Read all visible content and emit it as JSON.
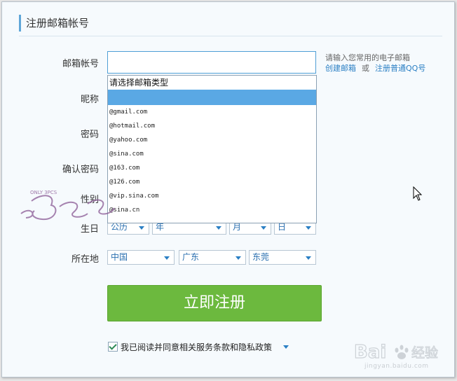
{
  "section": {
    "title": "注册邮箱帐号"
  },
  "labels": {
    "email": "邮箱帐号",
    "nickname": "昵称",
    "password": "密码",
    "confirm_password": "确认密码",
    "gender": "性别",
    "birthday": "生日",
    "location": "所在地"
  },
  "email_field": {
    "value": ""
  },
  "hint": {
    "text": "请输入您常用的电子邮箱",
    "create_link": "创建邮箱",
    "or": "或",
    "qq_link": "注册普通QQ号"
  },
  "email_dropdown": {
    "header": "请选择邮箱类型",
    "options": [
      "@gmail.com",
      "@hotmail.com",
      "@yahoo.com",
      "@sina.com",
      "@163.com",
      "@126.com",
      "@vip.sina.com",
      "@sina.cn"
    ]
  },
  "birthday": {
    "calendar": "公历",
    "year": "年",
    "month": "月",
    "day": "日"
  },
  "location": {
    "country": "中国",
    "province": "广东",
    "city": "东莞"
  },
  "register_button": "立即注册",
  "agreement": {
    "text": "我已阅读并同意相关服务条款和隐私政策",
    "checked": true
  },
  "watermark": {
    "baidu": "Bai",
    "baidu2": "经验",
    "url": "jingyan.baidu.com",
    "logo_text": "ONLY 3PCS"
  },
  "colors": {
    "accent": "#5fa6d8",
    "button": "#6cb93e",
    "link": "#2a7fc4",
    "selected": "#5aa8e4"
  },
  "icons": [
    "checkbox-check-icon",
    "dropdown-arrow-icon",
    "mouse-pointer-icon"
  ]
}
